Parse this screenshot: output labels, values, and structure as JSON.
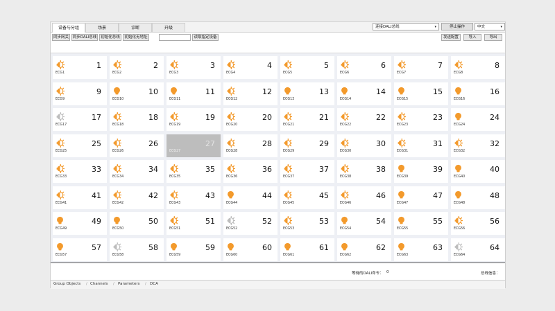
{
  "tabs": [
    "设备与分组",
    "场景",
    "诊断",
    "升级"
  ],
  "header": {
    "bus_select": "连接DALI总线",
    "stop_button": "停止操作",
    "language": "中文"
  },
  "toolbar": {
    "left_buttons": [
      "同步网关",
      "同步DALI总线",
      "初始化总线",
      "初始化无地址"
    ],
    "read_button": "读取指定设备",
    "right_buttons": [
      "发送配置",
      "导入",
      "导出"
    ]
  },
  "devices": [
    {
      "label": "ECG1",
      "num": "1",
      "icon": "dimmer"
    },
    {
      "label": "ECG2",
      "num": "2",
      "icon": "dimmer"
    },
    {
      "label": "ECG3",
      "num": "3",
      "icon": "dimmer"
    },
    {
      "label": "ECG4",
      "num": "4",
      "icon": "dimmer"
    },
    {
      "label": "ECG5",
      "num": "5",
      "icon": "dimmer"
    },
    {
      "label": "ECG6",
      "num": "6",
      "icon": "dimmer"
    },
    {
      "label": "ECG7",
      "num": "7",
      "icon": "dimmer"
    },
    {
      "label": "ECG8",
      "num": "8",
      "icon": "dimmer"
    },
    {
      "label": "ECG9",
      "num": "9",
      "icon": "dimmer"
    },
    {
      "label": "ECG10",
      "num": "10",
      "icon": "bulb"
    },
    {
      "label": "ECG11",
      "num": "11",
      "icon": "bulb"
    },
    {
      "label": "ECG12",
      "num": "12",
      "icon": "dimmer"
    },
    {
      "label": "ECG13",
      "num": "13",
      "icon": "bulb"
    },
    {
      "label": "ECG14",
      "num": "14",
      "icon": "bulb"
    },
    {
      "label": "ECG15",
      "num": "15",
      "icon": "bulb"
    },
    {
      "label": "ECG16",
      "num": "16",
      "icon": "bulb"
    },
    {
      "label": "ECG17",
      "num": "17",
      "icon": "dimmer-grey"
    },
    {
      "label": "ECG18",
      "num": "18",
      "icon": "dimmer"
    },
    {
      "label": "ECG19",
      "num": "19",
      "icon": "dimmer"
    },
    {
      "label": "ECG20",
      "num": "20",
      "icon": "dimmer"
    },
    {
      "label": "ECG21",
      "num": "21",
      "icon": "dimmer"
    },
    {
      "label": "ECG22",
      "num": "22",
      "icon": "dimmer"
    },
    {
      "label": "ECG23",
      "num": "23",
      "icon": "dimmer"
    },
    {
      "label": "ECG24",
      "num": "24",
      "icon": "bulb"
    },
    {
      "label": "ECG25",
      "num": "25",
      "icon": "dimmer"
    },
    {
      "label": "ECG26",
      "num": "26",
      "icon": "dimmer"
    },
    {
      "label": "ECG27",
      "num": "27",
      "icon": "dimmer-grey",
      "selected": true
    },
    {
      "label": "ECG28",
      "num": "28",
      "icon": "dimmer"
    },
    {
      "label": "ECG29",
      "num": "29",
      "icon": "dimmer"
    },
    {
      "label": "ECG30",
      "num": "30",
      "icon": "dimmer"
    },
    {
      "label": "ECG31",
      "num": "31",
      "icon": "dimmer"
    },
    {
      "label": "ECG32",
      "num": "32",
      "icon": "dimmer"
    },
    {
      "label": "ECG33",
      "num": "33",
      "icon": "dimmer"
    },
    {
      "label": "ECG34",
      "num": "34",
      "icon": "dimmer"
    },
    {
      "label": "ECG35",
      "num": "35",
      "icon": "dimmer"
    },
    {
      "label": "ECG36",
      "num": "36",
      "icon": "dimmer"
    },
    {
      "label": "ECG37",
      "num": "37",
      "icon": "dimmer"
    },
    {
      "label": "ECG38",
      "num": "38",
      "icon": "dimmer"
    },
    {
      "label": "ECG39",
      "num": "39",
      "icon": "bulb"
    },
    {
      "label": "ECG40",
      "num": "40",
      "icon": "bulb"
    },
    {
      "label": "ECG41",
      "num": "41",
      "icon": "dimmer"
    },
    {
      "label": "ECG42",
      "num": "42",
      "icon": "dimmer"
    },
    {
      "label": "ECG43",
      "num": "43",
      "icon": "dimmer"
    },
    {
      "label": "ECG44",
      "num": "44",
      "icon": "bulb"
    },
    {
      "label": "ECG45",
      "num": "45",
      "icon": "dimmer"
    },
    {
      "label": "ECG46",
      "num": "46",
      "icon": "dimmer"
    },
    {
      "label": "ECG47",
      "num": "47",
      "icon": "bulb"
    },
    {
      "label": "ECG48",
      "num": "48",
      "icon": "bulb"
    },
    {
      "label": "ECG49",
      "num": "49",
      "icon": "bulb"
    },
    {
      "label": "ECG50",
      "num": "50",
      "icon": "bulb"
    },
    {
      "label": "ECG51",
      "num": "51",
      "icon": "dimmer"
    },
    {
      "label": "ECG52",
      "num": "52",
      "icon": "dimmer-grey"
    },
    {
      "label": "ECG53",
      "num": "53",
      "icon": "dimmer"
    },
    {
      "label": "ECG54",
      "num": "54",
      "icon": "bulb"
    },
    {
      "label": "ECG55",
      "num": "55",
      "icon": "bulb"
    },
    {
      "label": "ECG56",
      "num": "56",
      "icon": "dimmer"
    },
    {
      "label": "ECG57",
      "num": "57",
      "icon": "bulb"
    },
    {
      "label": "ECG58",
      "num": "58",
      "icon": "dimmer-grey"
    },
    {
      "label": "ECG59",
      "num": "59",
      "icon": "bulb"
    },
    {
      "label": "ECG60",
      "num": "60",
      "icon": "bulb"
    },
    {
      "label": "ECG61",
      "num": "61",
      "icon": "bulb"
    },
    {
      "label": "ECG62",
      "num": "62",
      "icon": "bulb"
    },
    {
      "label": "ECG63",
      "num": "63",
      "icon": "bulb"
    },
    {
      "label": "ECG64",
      "num": "64",
      "icon": "dimmer-grey"
    }
  ],
  "status": {
    "pending_label": "等待的DALI命令：",
    "pending_value": "0",
    "bus_info_label": "总线信息："
  },
  "bottom_tabs": [
    "Group Objects",
    "Channels",
    "Parameters",
    "DCA"
  ],
  "colors": {
    "accent": "#f39a2c",
    "inactive": "#bdbdbd",
    "selected": "#bdbdbd"
  }
}
